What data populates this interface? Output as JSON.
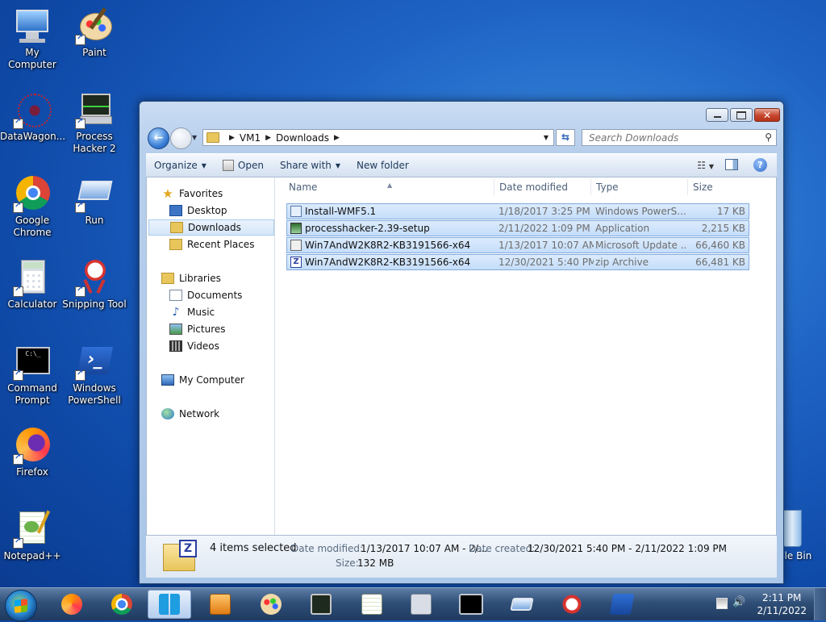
{
  "desktop": {
    "icons": [
      {
        "label": "My Computer",
        "icon": "computer-icon"
      },
      {
        "label": "Paint",
        "icon": "paint-palette-icon"
      },
      {
        "label": "DataWagon...",
        "icon": "datawagon-icon"
      },
      {
        "label": "Process Hacker 2",
        "icon": "process-hacker-icon"
      },
      {
        "label": "Google Chrome",
        "icon": "chrome-icon"
      },
      {
        "label": "Run",
        "icon": "run-icon"
      },
      {
        "label": "Calculator",
        "icon": "calculator-icon"
      },
      {
        "label": "Snipping Tool",
        "icon": "snipping-tool-icon"
      },
      {
        "label": "Command Prompt",
        "icon": "command-prompt-icon"
      },
      {
        "label": "Windows PowerShell",
        "icon": "powershell-icon"
      },
      {
        "label": "Firefox",
        "icon": "firefox-icon"
      },
      {
        "label": "Notepad++",
        "icon": "notepadpp-icon"
      }
    ],
    "recycle_bin_partial_label": "cle Bin"
  },
  "explorer": {
    "address": {
      "crumbs": [
        "VM1",
        "Downloads"
      ]
    },
    "search_placeholder": "Search Downloads",
    "toolbar": {
      "organize": "Organize",
      "open": "Open",
      "share_with": "Share with",
      "new_folder": "New folder"
    },
    "nav": {
      "favorites": "Favorites",
      "desktop": "Desktop",
      "downloads": "Downloads",
      "recent_places": "Recent Places",
      "libraries": "Libraries",
      "documents": "Documents",
      "music": "Music",
      "pictures": "Pictures",
      "videos": "Videos",
      "my_computer": "My Computer",
      "network": "Network"
    },
    "columns": {
      "name": "Name",
      "date": "Date modified",
      "type": "Type",
      "size": "Size"
    },
    "files": [
      {
        "name": "Install-WMF5.1",
        "date": "1/18/2017 3:25 PM",
        "type": "Windows PowerS...",
        "size": "17 KB",
        "icon": "powershell-script-icon"
      },
      {
        "name": "processhacker-2.39-setup",
        "date": "2/11/2022 1:09 PM",
        "type": "Application",
        "size": "2,215 KB",
        "icon": "application-icon"
      },
      {
        "name": "Win7AndW2K8R2-KB3191566-x64",
        "date": "1/13/2017 10:07 AM",
        "type": "Microsoft Update ...",
        "size": "66,460 KB",
        "icon": "msu-icon"
      },
      {
        "name": "Win7AndW2K8R2-KB3191566-x64",
        "date": "12/30/2021 5:40 PM",
        "type": "zip Archive",
        "size": "66,481 KB",
        "icon": "zip-icon"
      }
    ],
    "details": {
      "count": "4 items selected",
      "date_modified_label": "Date modified:",
      "date_modified_value": "1/13/2017 10:07 AM - 2/...",
      "date_created_label": "Date created:",
      "date_created_value": "12/30/2021 5:40 PM - 2/11/2022 1:09 PM",
      "size_label": "Size:",
      "size_value": "132 MB",
      "zip_badge": "Z"
    }
  },
  "taskbar": {
    "items": [
      "firefox-icon",
      "chrome-icon",
      "windows-explorer-icon",
      "media-player-icon",
      "paint-palette-icon",
      "process-hacker-icon",
      "notepadpp-icon",
      "calculator-icon",
      "command-prompt-icon",
      "run-icon",
      "snipping-tool-icon",
      "powershell-icon"
    ],
    "time": "2:11 PM",
    "date": "2/11/2022"
  }
}
